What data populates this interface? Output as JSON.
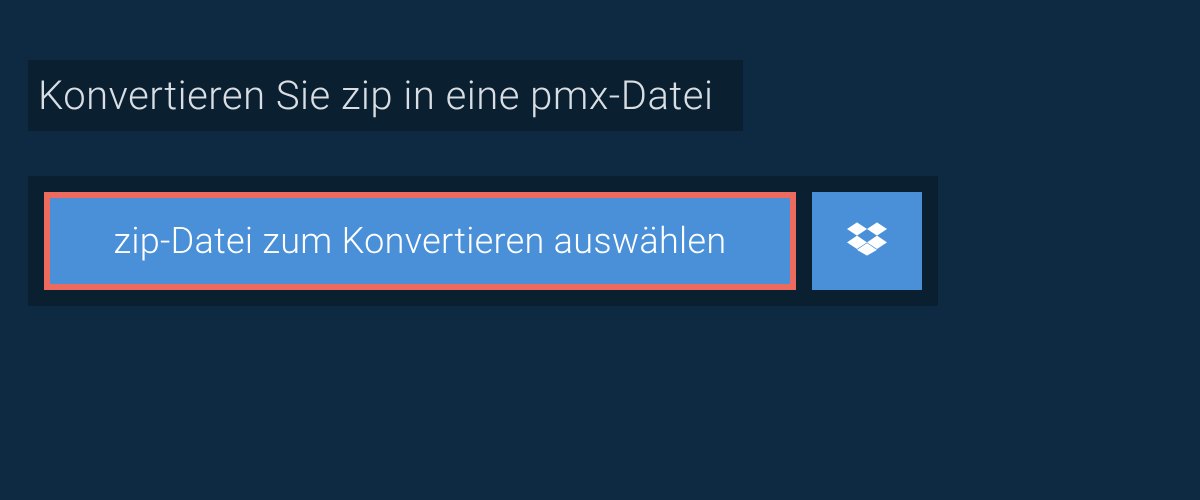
{
  "page": {
    "title": "Konvertieren Sie zip in eine pmx-Datei"
  },
  "actions": {
    "select_file_label": "zip-Datei zum Konvertieren auswählen",
    "dropbox_icon": "dropbox-icon"
  },
  "colors": {
    "background": "#0e2a42",
    "panel": "#0a1f30",
    "button": "#4a90d9",
    "highlight_border": "#ed6a5e",
    "text_light": "#d8dee3",
    "text_white": "#ffffff"
  }
}
